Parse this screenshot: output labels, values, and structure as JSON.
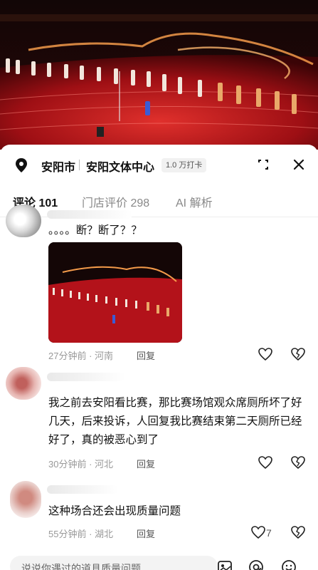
{
  "header": {
    "city": "安阳市",
    "venue": "安阳文体中心",
    "checkins": "1.0 万打卡"
  },
  "tabs": [
    {
      "label": "评论 101",
      "active": true
    },
    {
      "label": "门店评价 298",
      "active": false
    },
    {
      "label": "AI 解析",
      "active": false
    }
  ],
  "comments": [
    {
      "text": "。。。。断？断了？？",
      "has_image": true,
      "meta": "27分钟前 · 河南",
      "reply": "回复",
      "likes": ""
    },
    {
      "text": "我之前去安阳看比赛，那比赛场馆观众席厕所坏了好几天，后来投诉，人回复我比赛结束第二天厕所已经好了，真的被恶心到了",
      "has_image": false,
      "meta": "30分钟前 · 河北",
      "reply": "回复",
      "likes": ""
    },
    {
      "text": "这种场合还会出现质量问题",
      "has_image": false,
      "meta": "55分钟前 · 湖北",
      "reply": "回复",
      "likes": "7"
    }
  ],
  "input": {
    "placeholder": "说说你遇过的道具质量问题"
  },
  "icons": {
    "location": "location-pin-icon",
    "expand": "expand-icon",
    "close": "close-icon",
    "like": "heart-icon",
    "dislike": "broken-heart-icon",
    "image": "image-icon",
    "mention": "at-icon",
    "emoji": "emoji-icon"
  },
  "colors": {
    "accent": "#111111",
    "track_red": "#b3121a"
  }
}
